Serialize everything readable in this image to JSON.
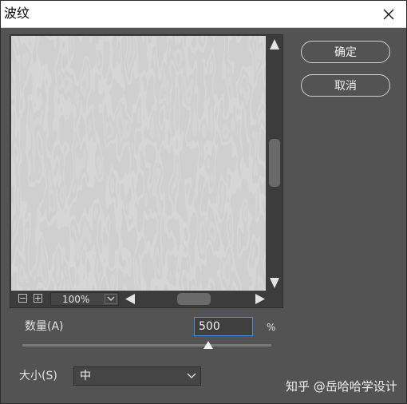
{
  "window": {
    "title": "波纹",
    "close_icon": "close-icon"
  },
  "preview": {
    "zoom": "100%",
    "zoom_out_glyph": "−",
    "zoom_in_glyph": "+"
  },
  "buttons": {
    "ok_label": "确定",
    "cancel_label": "取消"
  },
  "amount": {
    "label": "数量(A)",
    "value": "500",
    "unit": "%",
    "slider_fraction": 0.747
  },
  "size": {
    "label": "大小(S)",
    "selected": "中"
  },
  "watermark": "知乎 @岳哈哈学设计",
  "colors": {
    "dialog_bg": "#535353",
    "input_focus_border": "#4b8ee0"
  }
}
